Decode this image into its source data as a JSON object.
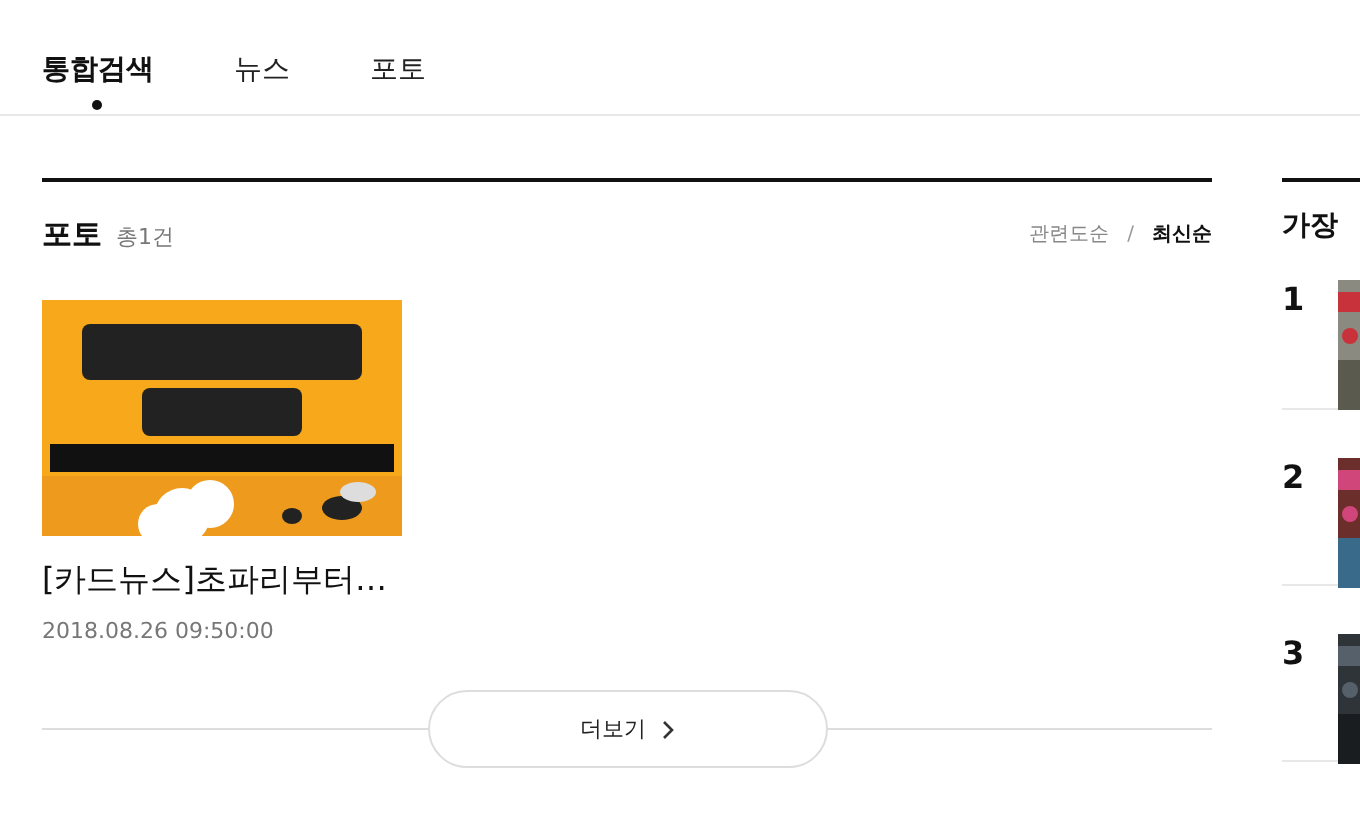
{
  "tabs": [
    {
      "label": "통합검색",
      "selected": true
    },
    {
      "label": "뉴스",
      "selected": false
    },
    {
      "label": "포토",
      "selected": false
    }
  ],
  "section": {
    "title": "포토",
    "count": "총1건",
    "separator": "/",
    "sort": [
      {
        "label": "관련도순",
        "selected": false
      },
      {
        "label": "최신순",
        "selected": true
      }
    ]
  },
  "photos": [
    {
      "title": "[카드뉴스]초파리부터…",
      "date": "2018.08.26 09:50:00"
    }
  ],
  "more_button": {
    "label": "더보기"
  },
  "sidebar": {
    "title": "가장",
    "items": [
      {
        "rank": "1"
      },
      {
        "rank": "2"
      },
      {
        "rank": "3"
      }
    ]
  }
}
